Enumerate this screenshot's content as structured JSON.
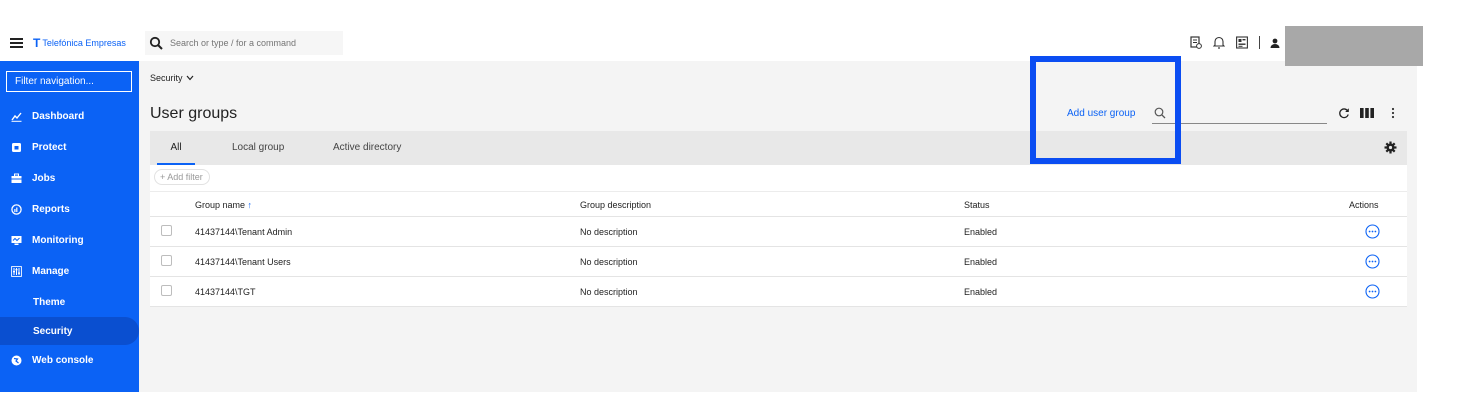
{
  "app": {
    "brand_mark": "T",
    "brand_name": "Telefónica Empresas"
  },
  "topbar": {
    "search_placeholder": "Search or type / for a command"
  },
  "sidebar": {
    "filter_placeholder": "Filter navigation...",
    "items": [
      {
        "label": "Dashboard",
        "icon": "chart-icon"
      },
      {
        "label": "Protect",
        "icon": "shield-icon"
      },
      {
        "label": "Jobs",
        "icon": "briefcase-icon"
      },
      {
        "label": "Reports",
        "icon": "report-icon"
      },
      {
        "label": "Monitoring",
        "icon": "monitor-icon"
      },
      {
        "label": "Manage",
        "icon": "sliders-icon"
      },
      {
        "label": "Theme",
        "icon": ""
      },
      {
        "label": "Security",
        "icon": ""
      },
      {
        "label": "Web console",
        "icon": "globe-icon"
      }
    ],
    "active": "Security"
  },
  "breadcrumb": {
    "label": "Security"
  },
  "page": {
    "title": "User groups",
    "add_label": "Add user group",
    "search_value": ""
  },
  "tabs": [
    {
      "label": "All",
      "active": true
    },
    {
      "label": "Local group",
      "active": false
    },
    {
      "label": "Active directory",
      "active": false
    }
  ],
  "table": {
    "add_filter": "Add filter",
    "columns": {
      "name": "Group name",
      "description": "Group description",
      "status": "Status",
      "actions": "Actions"
    },
    "rows": [
      {
        "name": "41437144\\Tenant Admin",
        "description": "No description",
        "status": "Enabled"
      },
      {
        "name": "41437144\\Tenant Users",
        "description": "No description",
        "status": "Enabled"
      },
      {
        "name": "41437144\\TGT",
        "description": "No description",
        "status": "Enabled"
      }
    ]
  },
  "colors": {
    "brand": "#0b62f5",
    "highlight": "#0b4df2"
  }
}
